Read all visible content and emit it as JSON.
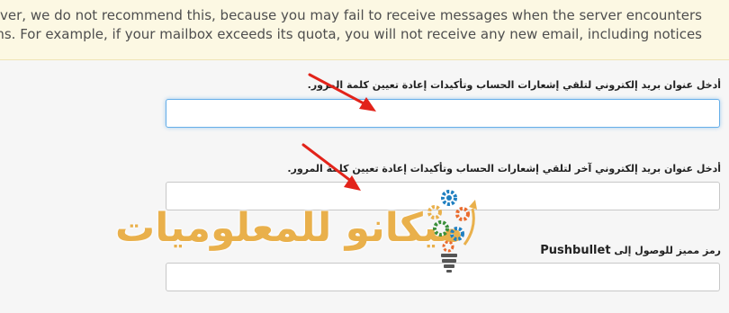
{
  "notice": {
    "line1": "r hosts. However, we do not recommend this, because you may fail to receive messages when the server encounters",
    "line2": ".problems. For example, if your mailbox exceeds its quota, you will not receive any new email, including notices"
  },
  "fields": {
    "email": {
      "label": "أدخل عنوان بريد إلكتروني لتلقي إشعارات الحساب وتأكيدات إعادة تعيين كلمة المرور.",
      "value": ""
    },
    "alt_email": {
      "label": "أدخل عنوان بريد إلكتروني آخر لتلقي إشعارات الحساب وتأكيدات إعادة تعيين كلمة المرور.",
      "value": ""
    },
    "pushbullet": {
      "label_prefix": "رمز مميز للوصول إلى",
      "label_brand": "Pushbullet",
      "value": ""
    }
  },
  "watermark": {
    "text": "ميكانو للمعلوميات",
    "icon": "lightbulb-gears-icon",
    "colors": {
      "text_blue": "#1f5fa8",
      "text_gold": "#e9b04b"
    }
  },
  "annotations": {
    "arrow_color": "#e2231a",
    "icon": "red-arrow-icon"
  },
  "colors": {
    "notice_bg": "#fcf8e3",
    "focus_border": "#66afe9",
    "page_bg": "#f6f6f6"
  }
}
